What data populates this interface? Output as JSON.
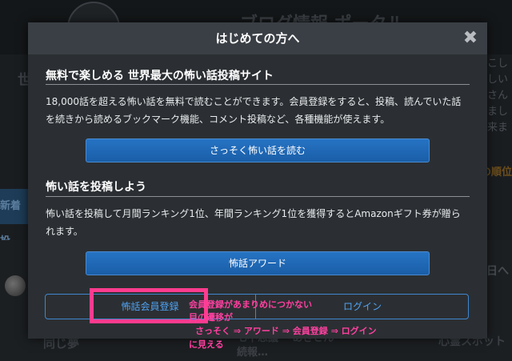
{
  "background": {
    "ghost_title": "ブログ情報 ポータル",
    "hero_text": "世",
    "side_text": "…こしたしいあさんにました来まし",
    "orange_text": "の順位",
    "tab_label": "新着投",
    "right_day_text": "日へ",
    "bottom_left_text": "同じ夢",
    "bottom_mid_text": "七不思議 〜あきさん〜 続報…",
    "bottom_right_text": "心霊スポット"
  },
  "modal": {
    "title": "はじめての方へ",
    "close_label": "✖",
    "section1": {
      "title": "無料で楽しめる 世界最大の怖い話投稿サイト",
      "body": "18,000話を超える怖い話を無料で読むことができます。会員登録をすると、投稿、読んでいた話を続きから読めるブックマーク機能、コメント投稿など、各種機能が使えます。",
      "button_label": "さっそく怖い話を読む"
    },
    "section2": {
      "title": "怖い話を投稿しよう",
      "body": "怖い話を投稿して月間ランキング1位、年間ランキング1位を獲得するとAmazonギフト券が贈られます。",
      "button_label": "怖話アワード"
    },
    "register_label": "怖話会員登録",
    "login_label": "ログイン"
  },
  "annotation": {
    "line1": "会員登録があまりめにつかない",
    "line2": "目の遷移が",
    "line3": "さっそく ⇒ アワード ⇒ 会員登録 ⇒ ログイン",
    "line4": "に見える",
    "color": "#ff40a0"
  }
}
